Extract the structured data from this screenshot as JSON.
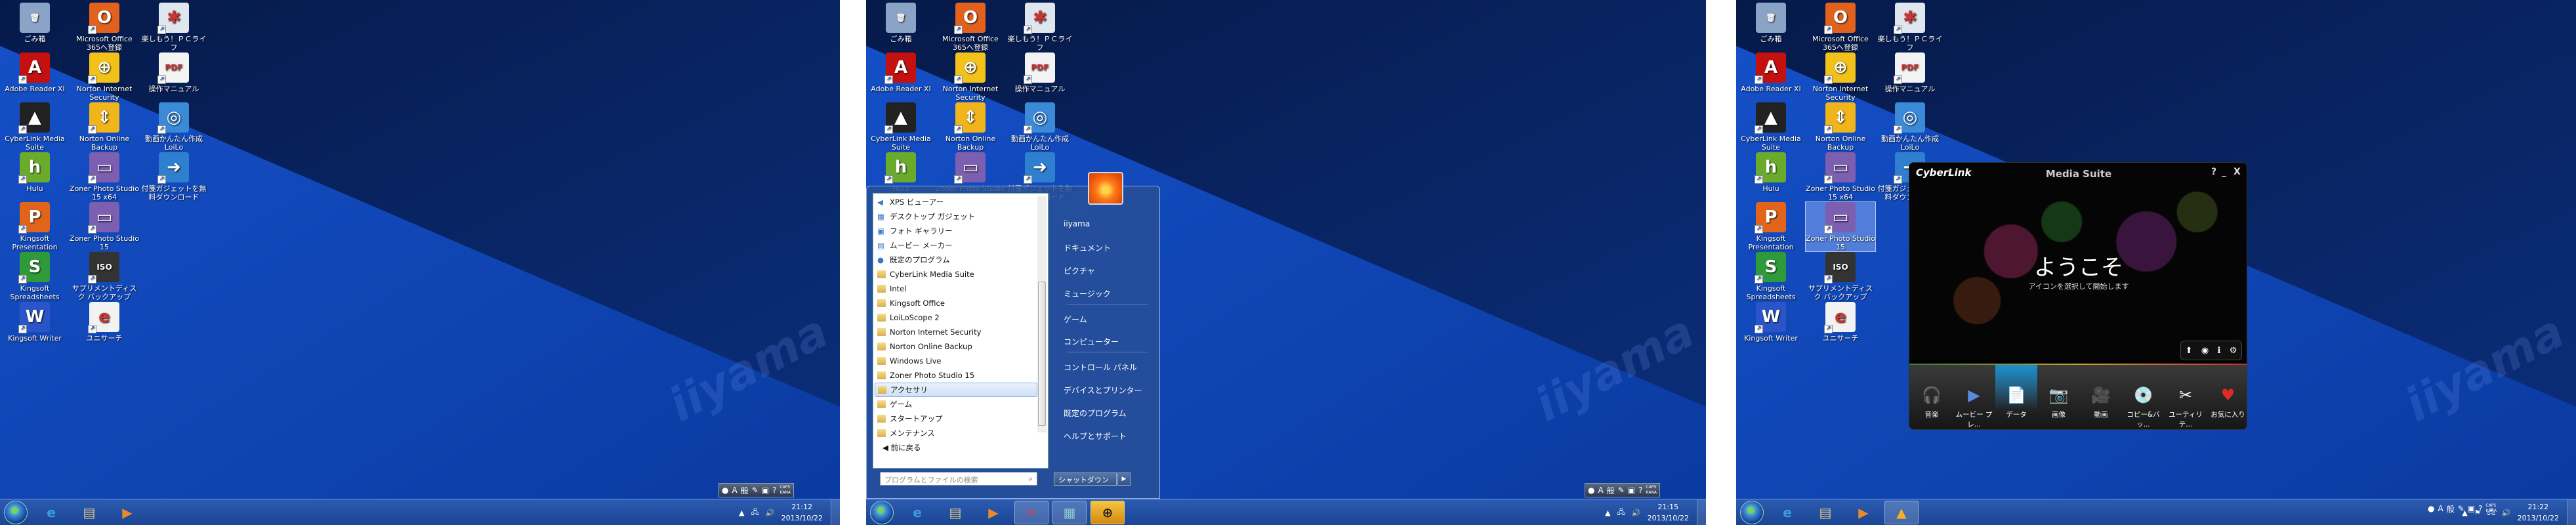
{
  "desktop_icons": [
    {
      "label": "ごみ箱",
      "glyph": "🗑",
      "color": "#8aa4c8"
    },
    {
      "label": "Microsoft Office 365へ登録",
      "glyph": "O",
      "color": "#e2621d"
    },
    {
      "label": "楽しもう！ＰＣライフ",
      "glyph": "✱",
      "color": "#dfe6ee"
    },
    {
      "label": "Adobe Reader XI",
      "glyph": "A",
      "color": "#c4100e"
    },
    {
      "label": "Norton Internet Security",
      "glyph": "⊕",
      "color": "#f2c21a"
    },
    {
      "label": "操作マニュアル",
      "glyph": "PDF",
      "color": "#f3f3f3"
    },
    {
      "label": "CyberLink Media Suite",
      "glyph": "▲",
      "color": "#222"
    },
    {
      "label": "Norton Online Backup",
      "glyph": "⇕",
      "color": "#f0b51a"
    },
    {
      "label": "動画かんたん作成 LoiLo",
      "glyph": "◎",
      "color": "#3a8ad8"
    },
    {
      "label": "Hulu",
      "glyph": "h",
      "color": "#6aab2c"
    },
    {
      "label": "Zoner Photo Studio 15 x64",
      "glyph": "▭",
      "color": "#7c5fb0"
    },
    {
      "label": "付箋ガジェットを無料ダウンロード",
      "glyph": "➜",
      "color": "#2f7fd0"
    },
    {
      "label": "Kingsoft Presentation",
      "glyph": "P",
      "color": "#e2641a"
    },
    {
      "label": "Zoner Photo Studio 15",
      "glyph": "▭",
      "color": "#7c5fb0"
    },
    {
      "label": "Kingsoft Spreadsheets",
      "glyph": "S",
      "color": "#2e9a3a"
    },
    {
      "label": "サプリメントディスク バックアップ",
      "glyph": "ISO",
      "color": "#333"
    },
    {
      "label": "Kingsoft Writer",
      "glyph": "W",
      "color": "#2a55c8"
    },
    {
      "label": "ユニサーチ",
      "glyph": "e",
      "color": "#f2f2f2"
    }
  ],
  "wallpaper_watermark": "iiyama",
  "screens": [
    {
      "clock_time": "21:12",
      "clock_date": "2013/10/22"
    },
    {
      "clock_time": "21:15",
      "clock_date": "2013/10/22"
    },
    {
      "clock_time": "21:22",
      "clock_date": "2013/10/22"
    }
  ],
  "langbar": {
    "mode": "A",
    "ime": "般",
    "caps": "CAPS",
    "kana": "KANA"
  },
  "start_menu": {
    "programs": [
      {
        "label": "XPS ビューアー",
        "type": "app",
        "glyph": "◀"
      },
      {
        "label": "デスクトップ ガジェット",
        "type": "app",
        "glyph": "▦"
      },
      {
        "label": "フォト ギャラリー",
        "type": "app",
        "glyph": "▣"
      },
      {
        "label": "ムービー メーカー",
        "type": "app",
        "glyph": "▤"
      },
      {
        "label": "既定のプログラム",
        "type": "app",
        "glyph": "●"
      },
      {
        "label": "CyberLink Media Suite",
        "type": "folder"
      },
      {
        "label": "Intel",
        "type": "folder"
      },
      {
        "label": "Kingsoft Office",
        "type": "folder"
      },
      {
        "label": "LoiLoScope 2",
        "type": "folder"
      },
      {
        "label": "Norton Internet Security",
        "type": "folder"
      },
      {
        "label": "Norton Online Backup",
        "type": "folder"
      },
      {
        "label": "Windows Live",
        "type": "folder"
      },
      {
        "label": "Zoner Photo Studio 15",
        "type": "folder"
      },
      {
        "label": "アクセサリ",
        "type": "folder",
        "highlighted": true
      },
      {
        "label": "ゲーム",
        "type": "folder"
      },
      {
        "label": "スタートアップ",
        "type": "folder"
      },
      {
        "label": "メンテナンス",
        "type": "folder"
      }
    ],
    "back_label": "前に戻る",
    "search_placeholder": "プログラムとファイルの検索",
    "right_items": [
      "iiyama",
      "ドキュメント",
      "ピクチャ",
      "ミュージック",
      "ゲーム",
      "コンピューター",
      "コントロール パネル",
      "デバイスとプリンター",
      "既定のプログラム",
      "ヘルプとサポート"
    ],
    "shutdown_label": "シャットダウン"
  },
  "media_suite": {
    "logo": "CyberLink",
    "title": "Media Suite",
    "help": "?",
    "minimize": "_",
    "close": "X",
    "welcome": "ようこそ",
    "subtitle": "アイコンを選択して開始します",
    "tools": [
      "⬆",
      "◉",
      "ℹ",
      "⚙"
    ],
    "categories": [
      {
        "label": "音楽",
        "glyph": "🎧"
      },
      {
        "label": "ムービー プレ...",
        "glyph": "▶"
      },
      {
        "label": "データ",
        "glyph": "📄",
        "selected": true
      },
      {
        "label": "画像",
        "glyph": "📷"
      },
      {
        "label": "動画",
        "glyph": "🎥"
      },
      {
        "label": "コピー&バッ...",
        "glyph": "💿"
      },
      {
        "label": "ユーティリテ...",
        "glyph": "✂"
      },
      {
        "label": "お気に入り",
        "glyph": "♥"
      }
    ]
  }
}
